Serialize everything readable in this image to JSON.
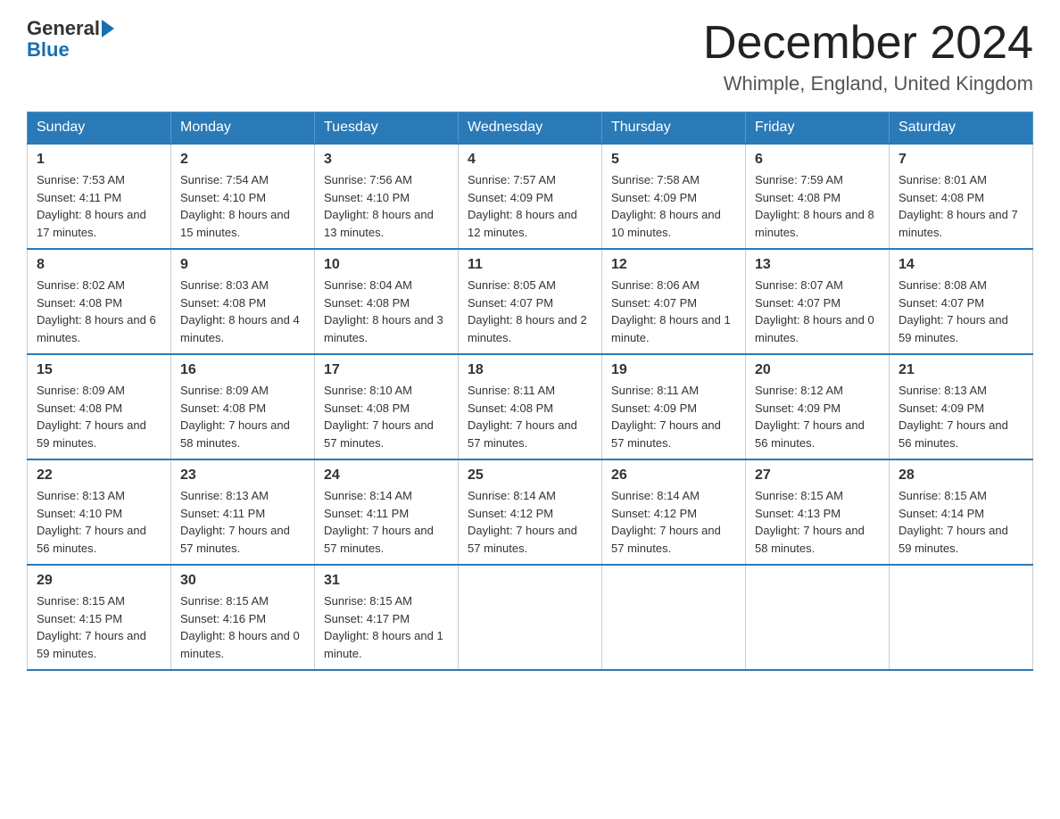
{
  "header": {
    "logo_text_general": "General",
    "logo_text_blue": "Blue",
    "month_title": "December 2024",
    "location": "Whimple, England, United Kingdom"
  },
  "days_of_week": [
    "Sunday",
    "Monday",
    "Tuesday",
    "Wednesday",
    "Thursday",
    "Friday",
    "Saturday"
  ],
  "weeks": [
    [
      {
        "day": "1",
        "sunrise": "7:53 AM",
        "sunset": "4:11 PM",
        "daylight": "8 hours and 17 minutes."
      },
      {
        "day": "2",
        "sunrise": "7:54 AM",
        "sunset": "4:10 PM",
        "daylight": "8 hours and 15 minutes."
      },
      {
        "day": "3",
        "sunrise": "7:56 AM",
        "sunset": "4:10 PM",
        "daylight": "8 hours and 13 minutes."
      },
      {
        "day": "4",
        "sunrise": "7:57 AM",
        "sunset": "4:09 PM",
        "daylight": "8 hours and 12 minutes."
      },
      {
        "day": "5",
        "sunrise": "7:58 AM",
        "sunset": "4:09 PM",
        "daylight": "8 hours and 10 minutes."
      },
      {
        "day": "6",
        "sunrise": "7:59 AM",
        "sunset": "4:08 PM",
        "daylight": "8 hours and 8 minutes."
      },
      {
        "day": "7",
        "sunrise": "8:01 AM",
        "sunset": "4:08 PM",
        "daylight": "8 hours and 7 minutes."
      }
    ],
    [
      {
        "day": "8",
        "sunrise": "8:02 AM",
        "sunset": "4:08 PM",
        "daylight": "8 hours and 6 minutes."
      },
      {
        "day": "9",
        "sunrise": "8:03 AM",
        "sunset": "4:08 PM",
        "daylight": "8 hours and 4 minutes."
      },
      {
        "day": "10",
        "sunrise": "8:04 AM",
        "sunset": "4:08 PM",
        "daylight": "8 hours and 3 minutes."
      },
      {
        "day": "11",
        "sunrise": "8:05 AM",
        "sunset": "4:07 PM",
        "daylight": "8 hours and 2 minutes."
      },
      {
        "day": "12",
        "sunrise": "8:06 AM",
        "sunset": "4:07 PM",
        "daylight": "8 hours and 1 minute."
      },
      {
        "day": "13",
        "sunrise": "8:07 AM",
        "sunset": "4:07 PM",
        "daylight": "8 hours and 0 minutes."
      },
      {
        "day": "14",
        "sunrise": "8:08 AM",
        "sunset": "4:07 PM",
        "daylight": "7 hours and 59 minutes."
      }
    ],
    [
      {
        "day": "15",
        "sunrise": "8:09 AM",
        "sunset": "4:08 PM",
        "daylight": "7 hours and 59 minutes."
      },
      {
        "day": "16",
        "sunrise": "8:09 AM",
        "sunset": "4:08 PM",
        "daylight": "7 hours and 58 minutes."
      },
      {
        "day": "17",
        "sunrise": "8:10 AM",
        "sunset": "4:08 PM",
        "daylight": "7 hours and 57 minutes."
      },
      {
        "day": "18",
        "sunrise": "8:11 AM",
        "sunset": "4:08 PM",
        "daylight": "7 hours and 57 minutes."
      },
      {
        "day": "19",
        "sunrise": "8:11 AM",
        "sunset": "4:09 PM",
        "daylight": "7 hours and 57 minutes."
      },
      {
        "day": "20",
        "sunrise": "8:12 AM",
        "sunset": "4:09 PM",
        "daylight": "7 hours and 56 minutes."
      },
      {
        "day": "21",
        "sunrise": "8:13 AM",
        "sunset": "4:09 PM",
        "daylight": "7 hours and 56 minutes."
      }
    ],
    [
      {
        "day": "22",
        "sunrise": "8:13 AM",
        "sunset": "4:10 PM",
        "daylight": "7 hours and 56 minutes."
      },
      {
        "day": "23",
        "sunrise": "8:13 AM",
        "sunset": "4:11 PM",
        "daylight": "7 hours and 57 minutes."
      },
      {
        "day": "24",
        "sunrise": "8:14 AM",
        "sunset": "4:11 PM",
        "daylight": "7 hours and 57 minutes."
      },
      {
        "day": "25",
        "sunrise": "8:14 AM",
        "sunset": "4:12 PM",
        "daylight": "7 hours and 57 minutes."
      },
      {
        "day": "26",
        "sunrise": "8:14 AM",
        "sunset": "4:12 PM",
        "daylight": "7 hours and 57 minutes."
      },
      {
        "day": "27",
        "sunrise": "8:15 AM",
        "sunset": "4:13 PM",
        "daylight": "7 hours and 58 minutes."
      },
      {
        "day": "28",
        "sunrise": "8:15 AM",
        "sunset": "4:14 PM",
        "daylight": "7 hours and 59 minutes."
      }
    ],
    [
      {
        "day": "29",
        "sunrise": "8:15 AM",
        "sunset": "4:15 PM",
        "daylight": "7 hours and 59 minutes."
      },
      {
        "day": "30",
        "sunrise": "8:15 AM",
        "sunset": "4:16 PM",
        "daylight": "8 hours and 0 minutes."
      },
      {
        "day": "31",
        "sunrise": "8:15 AM",
        "sunset": "4:17 PM",
        "daylight": "8 hours and 1 minute."
      },
      null,
      null,
      null,
      null
    ]
  ],
  "labels": {
    "sunrise": "Sunrise:",
    "sunset": "Sunset:",
    "daylight": "Daylight:"
  }
}
